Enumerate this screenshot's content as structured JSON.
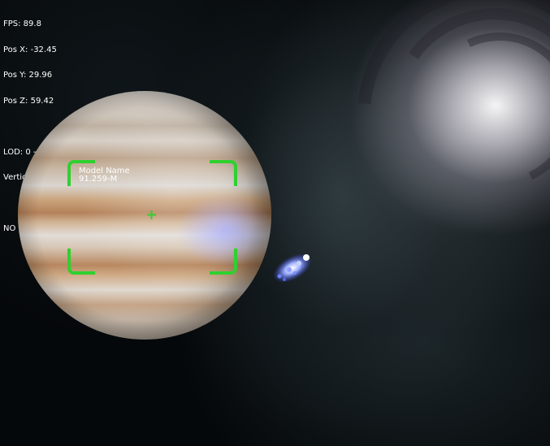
{
  "hud": {
    "fps": "FPS: 89.8",
    "pos_x": "Pos X: -32.45",
    "pos_y": "Pos Y: 29.96",
    "pos_z": "Pos Z: 59.42",
    "lod": "LOD: 0 - 6",
    "vertices": "Vertices: 24192",
    "status": "NO"
  },
  "target": {
    "name": "Model Name",
    "distance": "91.259-M"
  },
  "colors": {
    "hud_text": "#ffffff",
    "target_bracket": "#2fd02f",
    "ship_glow": "#6f8cff"
  },
  "icons": {
    "crosshair": "crosshair-icon",
    "brackets": "target-bracket-icon"
  }
}
